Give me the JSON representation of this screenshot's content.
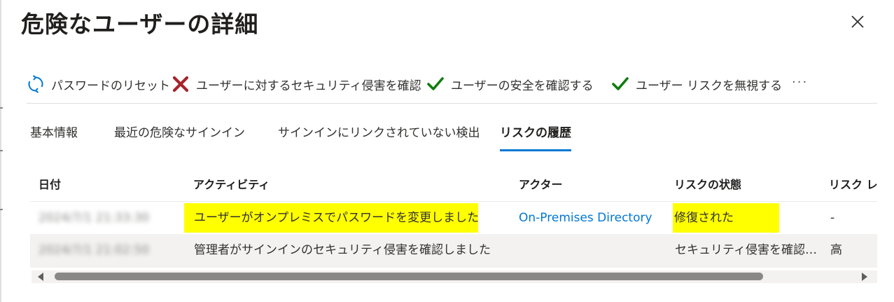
{
  "panel": {
    "title": "危険なユーザーの詳細",
    "close_icon": "close-icon"
  },
  "toolbar": {
    "reset_password": {
      "label": "パスワードのリセット",
      "icon": "refresh-icon"
    },
    "confirm_compromised": {
      "label": "ユーザーに対するセキュリティ侵害を確認",
      "icon": "x-icon",
      "icon_color": "#a4262c"
    },
    "confirm_safe": {
      "label": "ユーザーの安全を確認する",
      "icon": "checkmark-icon",
      "icon_color": "#107c10"
    },
    "dismiss_risk": {
      "label": "ユーザー リスクを無視する",
      "icon": "checkmark-icon",
      "icon_color": "#107c10"
    },
    "more_label": "···"
  },
  "tabs": [
    {
      "label": "基本情報",
      "active": false
    },
    {
      "label": "最近の危険なサインイン",
      "active": false
    },
    {
      "label": "サインインにリンクされていない検出",
      "active": false
    },
    {
      "label": "リスクの履歴",
      "active": true
    }
  ],
  "table": {
    "headers": {
      "date": "日付",
      "activity": "アクティビティ",
      "actor": "アクター",
      "risk_state": "リスクの状態",
      "risk_level": "リスク レベル"
    },
    "rows": [
      {
        "date": "2024/7/1 21:33:30",
        "activity": "ユーザーがオンプレミスでパスワードを変更しました",
        "actor": "On-Premises Directory",
        "risk_state": "修復された",
        "risk_level": "-"
      },
      {
        "date": "2024/7/1 21:02:50",
        "activity": "管理者がサインインのセキュリティ侵害を確認しました",
        "actor": "",
        "risk_state": "セキュリティ侵害を確認しました",
        "risk_level": "高"
      }
    ]
  },
  "colors": {
    "accent": "#0078d4",
    "highlight": "#ffff00",
    "alt_row": "#f3f2f1"
  }
}
